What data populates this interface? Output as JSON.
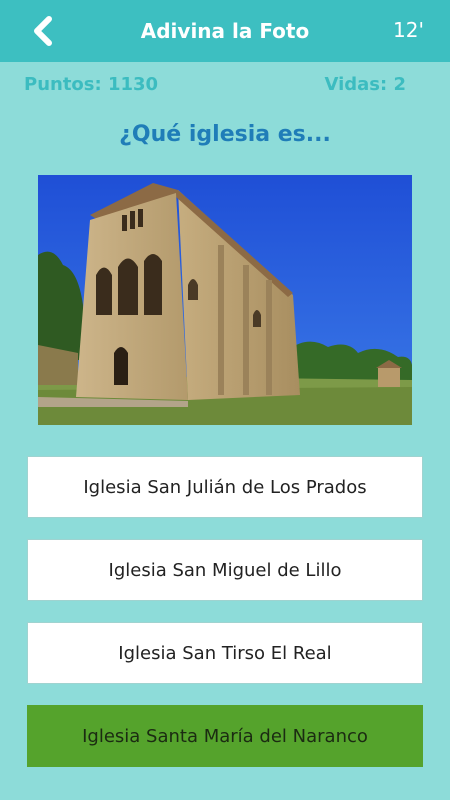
{
  "header": {
    "title": "Adivina la Foto",
    "timer": "12'",
    "back_icon": "chevron-left-icon"
  },
  "stats": {
    "points": "Puntos: 1130",
    "lives": "Vidas: 2"
  },
  "question": "¿Qué iglesia es...",
  "answers": [
    {
      "label": "Iglesia San Julián de Los Prados",
      "state": "default"
    },
    {
      "label": "Iglesia San Miguel de Lillo",
      "state": "default"
    },
    {
      "label": "Iglesia San Tirso El Real",
      "state": "default"
    },
    {
      "label": "Iglesia Santa María del Naranco",
      "state": "correct"
    }
  ],
  "colors": {
    "header_bg": "#3dbfc1",
    "page_bg": "#8ddcd9",
    "stats_text": "#3cbcc0",
    "question_text": "#1f7db8",
    "correct_answer": "#55a32c"
  }
}
